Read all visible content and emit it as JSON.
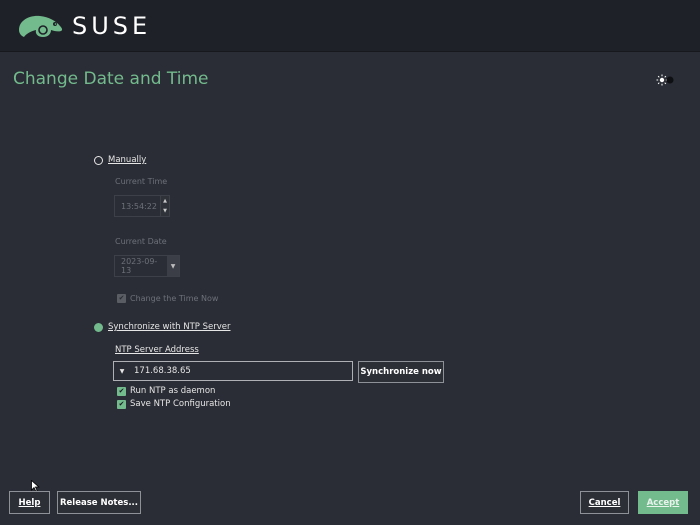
{
  "brand": {
    "name": "SUSE",
    "accent": "#73ba8d"
  },
  "page": {
    "title": "Change Date and Time"
  },
  "theme_toggle": {
    "icon": "sun-icon"
  },
  "manual": {
    "radio_label": "Manually",
    "current_time_label": "Current Time",
    "current_time_value": "13:54:22",
    "current_date_label": "Current Date",
    "current_date_value": "2023-09-13",
    "change_time_now_label": "Change the Time Now",
    "selected": false
  },
  "ntp": {
    "radio_label": "Synchronize with NTP Server",
    "selected": true,
    "server_label": "NTP Server Address",
    "server_value": "171.68.38.65",
    "sync_button": "Synchronize now",
    "run_daemon_label": "Run NTP as daemon",
    "save_config_label": "Save NTP Configuration"
  },
  "footer": {
    "help": "Help",
    "release_notes": "Release Notes...",
    "cancel": "Cancel",
    "accept": "Accept"
  }
}
